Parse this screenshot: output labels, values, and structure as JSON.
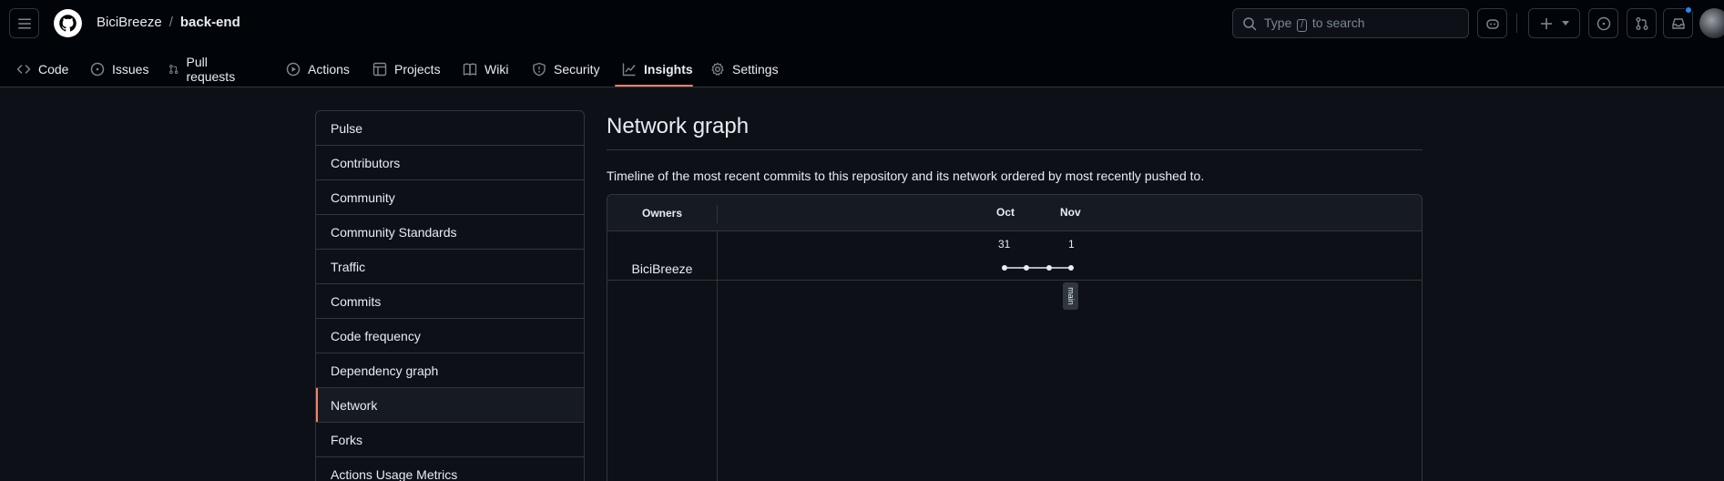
{
  "header": {
    "owner": "BiciBreeze",
    "separator": "/",
    "repo": "back-end",
    "search_prefix": "Type",
    "search_key": "/",
    "search_suffix": "to search"
  },
  "tabs": [
    {
      "label": "Code",
      "icon": "code-icon"
    },
    {
      "label": "Issues",
      "icon": "issue-opened-icon"
    },
    {
      "label": "Pull requests",
      "icon": "git-pull-request-icon"
    },
    {
      "label": "Actions",
      "icon": "play-icon"
    },
    {
      "label": "Projects",
      "icon": "table-icon"
    },
    {
      "label": "Wiki",
      "icon": "book-icon"
    },
    {
      "label": "Security",
      "icon": "shield-icon"
    },
    {
      "label": "Insights",
      "icon": "graph-icon",
      "active": true
    },
    {
      "label": "Settings",
      "icon": "gear-icon"
    }
  ],
  "sidebar": {
    "items": [
      {
        "label": "Pulse"
      },
      {
        "label": "Contributors"
      },
      {
        "label": "Community"
      },
      {
        "label": "Community Standards"
      },
      {
        "label": "Traffic"
      },
      {
        "label": "Commits"
      },
      {
        "label": "Code frequency"
      },
      {
        "label": "Dependency graph"
      },
      {
        "label": "Network",
        "selected": true
      },
      {
        "label": "Forks"
      },
      {
        "label": "Actions Usage Metrics"
      }
    ]
  },
  "main": {
    "title": "Network graph",
    "description": "Timeline of the most recent commits to this repository and its network ordered by most recently pushed to."
  },
  "network": {
    "owners_header": "Owners",
    "months": [
      "Oct",
      "Nov"
    ],
    "days": [
      "31",
      "1"
    ],
    "owner": "BiciBreeze",
    "branch": "main",
    "commit_count": 4
  },
  "colors": {
    "accent": "#f78166",
    "notification": "#2f81f7",
    "background": "#0d1117",
    "header": "#010409",
    "border": "#30363d"
  }
}
